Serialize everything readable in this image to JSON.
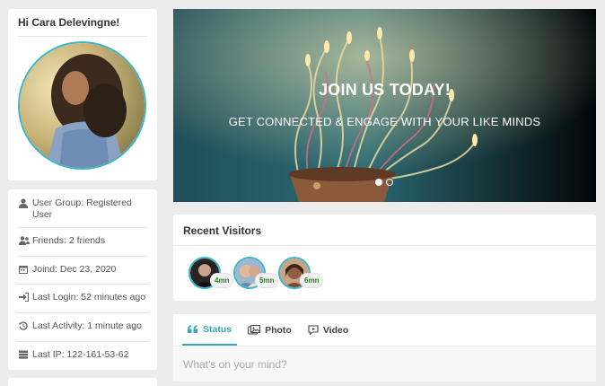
{
  "profile": {
    "greeting": "Hi Cara Delevingne!"
  },
  "info": {
    "user_group": "User Group: Registered User",
    "friends": "Friends: 2 friends",
    "joined": "Joind: Dec 23, 2020",
    "last_login": "Last Login: 52 minutes ago",
    "last_activity": "Last Activity: 1 minute ago",
    "last_ip": "Last IP: 122-161-53-62"
  },
  "hero": {
    "title": "JOIN US TODAY!",
    "subtitle": "GET CONNECTED & ENGAGE WITH YOUR LIKE MINDS",
    "slide_count": 2,
    "active_slide": 1
  },
  "visitors": {
    "heading": "Recent Visitors",
    "items": [
      {
        "time": "4mn"
      },
      {
        "time": "5mn"
      },
      {
        "time": "6mn"
      }
    ]
  },
  "composer": {
    "tabs": [
      {
        "label": "Status",
        "icon": "quote-icon"
      },
      {
        "label": "Photo",
        "icon": "photo-icon"
      },
      {
        "label": "Video",
        "icon": "video-icon"
      }
    ],
    "placeholder": "What's on your mind?"
  },
  "colors": {
    "accent": "#2fa8c0",
    "avatar_ring": "#3bb5c9",
    "badge_text": "#2f7a2f"
  }
}
